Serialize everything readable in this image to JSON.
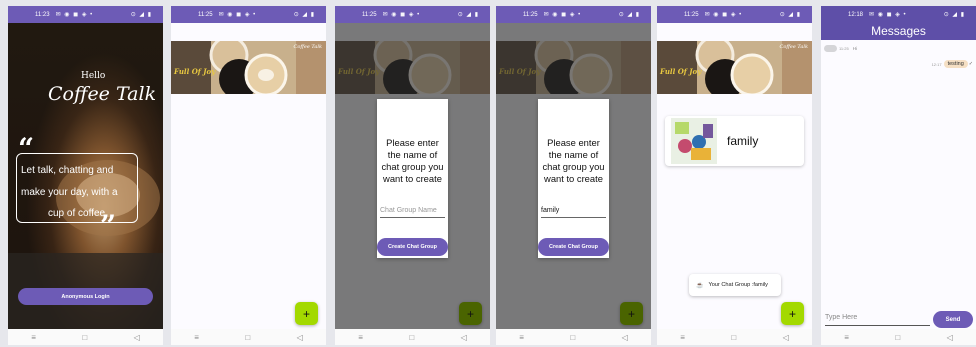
{
  "status_times": [
    "11:23",
    "11:25",
    "11:25",
    "11:25",
    "11:25",
    "12:18"
  ],
  "status_icons": "✉ ◉ ◼ ◈ •",
  "status_right": "⊙ ◢ ▮",
  "nav": {
    "menu": "≡",
    "home": "□",
    "back": "◁"
  },
  "welcome": {
    "hello": "Hello",
    "app_name": "Coffee Talk",
    "quote_l1": "Let talk, chatting and",
    "quote_l2": "make your day, with a",
    "quote_l3": "cup of coffee.",
    "login_button": "Anonymous Login"
  },
  "banner": {
    "left_text": "Full Of Joy",
    "right_text": "Coffee Talk"
  },
  "dialog": {
    "prompt_l1": "Please enter",
    "prompt_l2": "the name of",
    "prompt_l3": "chat group you",
    "prompt_l4": "want to create",
    "placeholder": "Chat Group Name",
    "value": "family",
    "button": "Create Chat Group"
  },
  "fab_icon": "+",
  "group_card": {
    "name": "family"
  },
  "toast": {
    "icon": "☕",
    "text": "Your Chat Group :family"
  },
  "messages": {
    "title": "Messages",
    "left_time": "11:25",
    "left_text": "Hi",
    "right_time": "12:17",
    "right_text": "testing",
    "input_placeholder": "Type Here",
    "send": "Send"
  },
  "colors": {
    "primary": "#6d5bb6",
    "fab": "#a3d900",
    "status": "#6d5bb6"
  }
}
